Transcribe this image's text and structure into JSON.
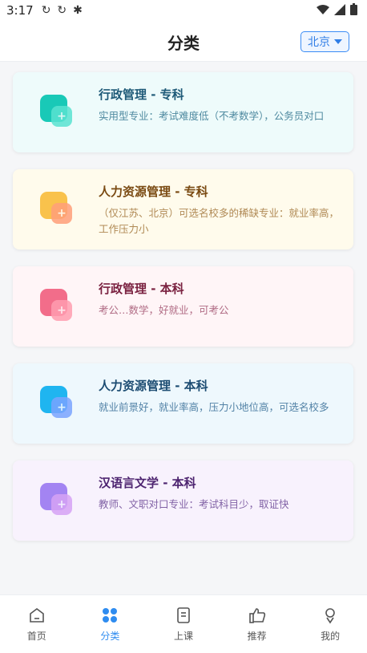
{
  "status": {
    "time": "3:17",
    "icons": [
      "sync-icon",
      "sync-icon",
      "bug-icon"
    ]
  },
  "header": {
    "title": "分类",
    "city": "北京"
  },
  "cards": [
    {
      "title": "行政管理 - 专科",
      "desc": "实用型专业：考试难度低（不考数学），公务员对口",
      "bg": "#eefbfb",
      "title_color": "#1e5a78",
      "desc_color": "#4f8aa0",
      "icon_back": "#19c9b7",
      "icon_front": "#59e3d1"
    },
    {
      "title": "人力资源管理 - 专科",
      "desc": "（仅江苏、北京）可选名校多的稀缺专业：就业率高，工作压力小",
      "bg": "#fffbec",
      "title_color": "#7a4a12",
      "desc_color": "#b08a55",
      "icon_back": "#f9c24c",
      "icon_front": "#ff9f7a"
    },
    {
      "title": "行政管理 - 本科",
      "desc": "考公…数学，好就业，可考公",
      "bg": "#fff5f7",
      "title_color": "#7a2140",
      "desc_color": "#b06b84",
      "icon_back": "#f26d8a",
      "icon_front": "#ff9db0"
    },
    {
      "title": "人力资源管理 - 本科",
      "desc": "就业前景好，就业率高，压力小地位高，可选名校多",
      "bg": "#eef8fd",
      "title_color": "#1c4c72",
      "desc_color": "#5282a6",
      "icon_back": "#1fb5f0",
      "icon_front": "#7aa4ff"
    },
    {
      "title": "汉语言文学 - 本科",
      "desc": "教师、文职对口专业：考试科目少，取证快",
      "bg": "#f8f2fd",
      "title_color": "#4d2470",
      "desc_color": "#8263a6",
      "icon_back": "#a384f2",
      "icon_front": "#d6a3f5"
    }
  ],
  "tabs": [
    {
      "label": "首页",
      "icon": "home-icon"
    },
    {
      "label": "分类",
      "icon": "category-icon",
      "active": true
    },
    {
      "label": "上课",
      "icon": "book-icon"
    },
    {
      "label": "推荐",
      "icon": "thumb-up-icon"
    },
    {
      "label": "我的",
      "icon": "profile-icon"
    }
  ]
}
